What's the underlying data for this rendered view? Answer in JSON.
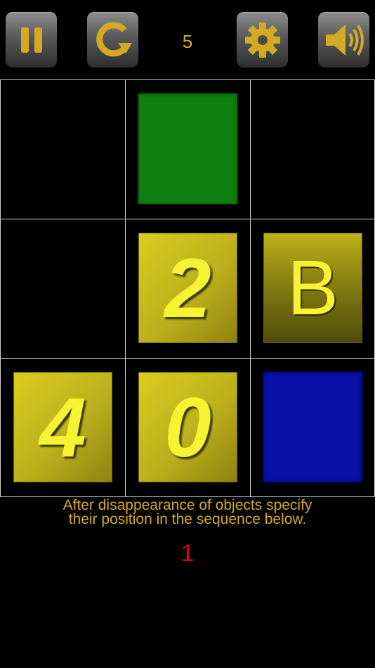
{
  "toolbar": {
    "pause_icon": "pause-icon",
    "restart_icon": "restart-icon",
    "level_value": "5",
    "settings_icon": "gear-icon",
    "sound_icon": "speaker-icon"
  },
  "colors": {
    "accent": "#d4aa22",
    "tile_gold": "#d9cc1f",
    "tile_green": "#0f7f0f",
    "tile_blue": "#0a0fa6",
    "answer_red": "#e00000",
    "grid_line": "#cfcfcf"
  },
  "grid": {
    "cells": [
      {
        "type": "empty",
        "label": ""
      },
      {
        "type": "green",
        "label": ""
      },
      {
        "type": "empty",
        "label": ""
      },
      {
        "type": "empty",
        "label": ""
      },
      {
        "type": "gold",
        "label": "2"
      },
      {
        "type": "goldB",
        "label": "B"
      },
      {
        "type": "gold",
        "label": "4"
      },
      {
        "type": "gold",
        "label": "0"
      },
      {
        "type": "blue",
        "label": ""
      }
    ]
  },
  "instruction": {
    "line1": "After disappearance of objects specify",
    "line2": "their position in the sequence below."
  },
  "answer": {
    "sequence": "1"
  }
}
